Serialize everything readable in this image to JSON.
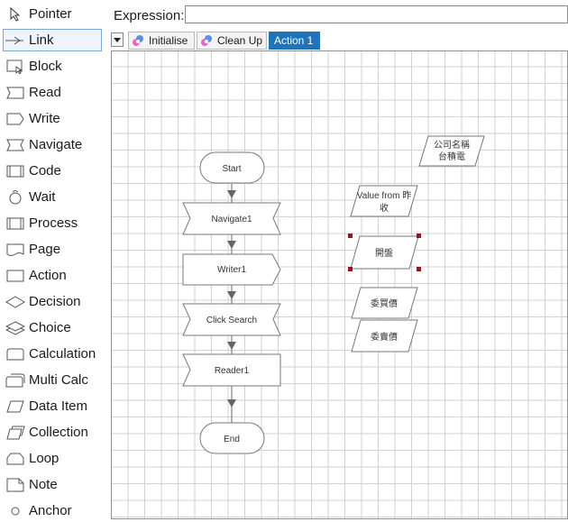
{
  "toolbox": {
    "items": [
      {
        "label": "Pointer",
        "icon": "pointer-icon"
      },
      {
        "label": "Link",
        "icon": "link-icon"
      },
      {
        "label": "Block",
        "icon": "block-icon"
      },
      {
        "label": "Read",
        "icon": "read-icon"
      },
      {
        "label": "Write",
        "icon": "write-icon"
      },
      {
        "label": "Navigate",
        "icon": "navigate-icon"
      },
      {
        "label": "Code",
        "icon": "code-icon"
      },
      {
        "label": "Wait",
        "icon": "wait-icon"
      },
      {
        "label": "Process",
        "icon": "process-icon"
      },
      {
        "label": "Page",
        "icon": "page-icon"
      },
      {
        "label": "Action",
        "icon": "action-icon"
      },
      {
        "label": "Decision",
        "icon": "decision-icon"
      },
      {
        "label": "Choice",
        "icon": "choice-icon"
      },
      {
        "label": "Calculation",
        "icon": "calculation-icon"
      },
      {
        "label": "Multi Calc",
        "icon": "multi-calc-icon"
      },
      {
        "label": "Data Item",
        "icon": "data-item-icon"
      },
      {
        "label": "Collection",
        "icon": "collection-icon"
      },
      {
        "label": "Loop",
        "icon": "loop-icon"
      },
      {
        "label": "Note",
        "icon": "note-icon"
      },
      {
        "label": "Anchor",
        "icon": "anchor-icon"
      }
    ],
    "selected": "Link"
  },
  "expression": {
    "label": "Expression:",
    "value": ""
  },
  "tabs": [
    {
      "label": "Initialise",
      "active": false
    },
    {
      "label": "Clean Up",
      "active": false
    },
    {
      "label": "Action 1",
      "active": true
    }
  ],
  "flow": {
    "start": "Start",
    "navigate": "Navigate1",
    "writer": "Writer1",
    "click_search": "Click Search",
    "reader": "Reader1",
    "end": "End"
  },
  "data_items": {
    "company_line1": "公司名稱",
    "company_line2": "台積電",
    "value_from_line1": "Value from 昨",
    "value_from_line2": "收",
    "open": "開盤",
    "bid1": "委買價",
    "bid2": "委賣價"
  },
  "colors": {
    "active_tab": "#1f73b8",
    "selection_handle": "#8b1a1a",
    "grid": "#d2d2d2"
  }
}
